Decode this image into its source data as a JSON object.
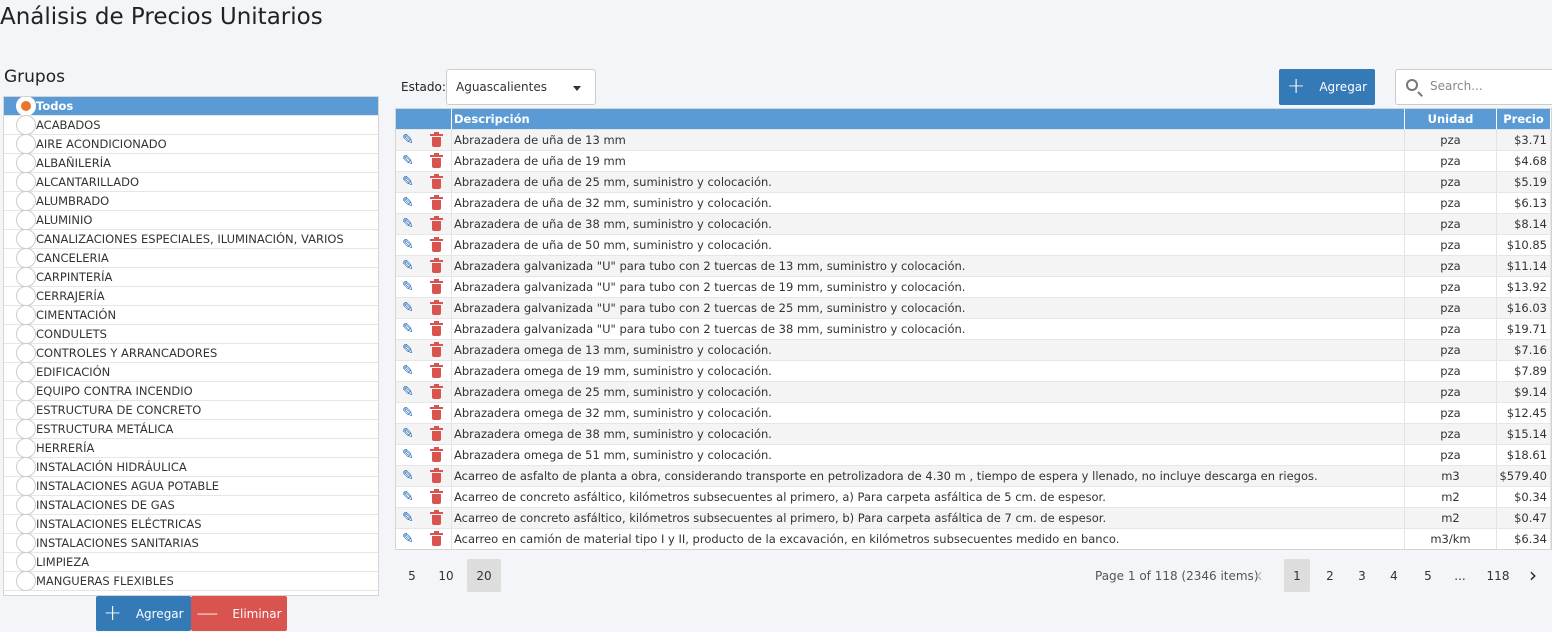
{
  "page_title": "Análisis de Precios Unitarios",
  "groups": {
    "title": "Grupos",
    "items": [
      {
        "label": "Todos",
        "selected": true
      },
      {
        "label": "ACABADOS"
      },
      {
        "label": "AIRE ACONDICIONADO"
      },
      {
        "label": "ALBAÑILERÍA"
      },
      {
        "label": "ALCANTARILLADO"
      },
      {
        "label": "ALUMBRADO"
      },
      {
        "label": "ALUMINIO"
      },
      {
        "label": "CANALIZACIONES ESPECIALES, ILUMINACIÓN, VARIOS"
      },
      {
        "label": "CANCELERIA"
      },
      {
        "label": "CARPINTERÍA"
      },
      {
        "label": "CERRAJERÍA"
      },
      {
        "label": "CIMENTACIÓN"
      },
      {
        "label": "CONDULETS"
      },
      {
        "label": "CONTROLES Y ARRANCADORES"
      },
      {
        "label": "EDIFICACIÓN"
      },
      {
        "label": "EQUIPO CONTRA INCENDIO"
      },
      {
        "label": "ESTRUCTURA DE CONCRETO"
      },
      {
        "label": "ESTRUCTURA METÁLICA"
      },
      {
        "label": "HERRERÍA"
      },
      {
        "label": "INSTALACIÓN HIDRÁULICA"
      },
      {
        "label": "INSTALACIONES AGUA POTABLE"
      },
      {
        "label": "INSTALACIONES DE GAS"
      },
      {
        "label": "INSTALACIONES ELÉCTRICAS"
      },
      {
        "label": "INSTALACIONES SANITARIAS"
      },
      {
        "label": "LIMPIEZA"
      },
      {
        "label": "MANGUERAS FLEXIBLES"
      }
    ],
    "add_label": "Agregar",
    "delete_label": "Eliminar"
  },
  "toolbar": {
    "estado_label": "Estado:",
    "estado_value": "Aguascalientes",
    "add_label": "Agregar",
    "search_placeholder": "Search..."
  },
  "table": {
    "columns": [
      "Descripción",
      "Unidad",
      "Precio"
    ],
    "rows": [
      [
        "Abrazadera de uña de 13 mm",
        "pza",
        "$3.71"
      ],
      [
        "Abrazadera de uña de 19 mm",
        "pza",
        "$4.68"
      ],
      [
        "Abrazadera de uña de 25 mm, suministro y colocación.",
        "pza",
        "$5.19"
      ],
      [
        "Abrazadera de uña de 32 mm, suministro y colocación.",
        "pza",
        "$6.13"
      ],
      [
        "Abrazadera de uña de 38 mm, suministro y colocación.",
        "pza",
        "$8.14"
      ],
      [
        "Abrazadera de uña de 50 mm, suministro y colocación.",
        "pza",
        "$10.85"
      ],
      [
        "Abrazadera galvanizada \"U\" para tubo con 2 tuercas de 13 mm, suministro y colocación.",
        "pza",
        "$11.14"
      ],
      [
        "Abrazadera galvanizada \"U\" para tubo con 2 tuercas de 19 mm, suministro y colocación.",
        "pza",
        "$13.92"
      ],
      [
        "Abrazadera galvanizada \"U\" para tubo con 2 tuercas de 25 mm, suministro y colocación.",
        "pza",
        "$16.03"
      ],
      [
        "Abrazadera galvanizada \"U\" para tubo con 2 tuercas de 38 mm, suministro y colocación.",
        "pza",
        "$19.71"
      ],
      [
        "Abrazadera omega de 13 mm, suministro y colocación.",
        "pza",
        "$7.16"
      ],
      [
        "Abrazadera omega de 19 mm, suministro y colocación.",
        "pza",
        "$7.89"
      ],
      [
        "Abrazadera omega de 25 mm, suministro y colocación.",
        "pza",
        "$9.14"
      ],
      [
        "Abrazadera omega de 32 mm, suministro y colocación.",
        "pza",
        "$12.45"
      ],
      [
        "Abrazadera omega de 38 mm, suministro y colocación.",
        "pza",
        "$15.14"
      ],
      [
        "Abrazadera omega de 51 mm, suministro y colocación.",
        "pza",
        "$18.61"
      ],
      [
        "Acarreo de asfalto de planta a obra, considerando transporte en petrolizadora de 4.30 m , tiempo de espera y llenado, no incluye descarga en riegos.",
        "m3",
        "$579.40"
      ],
      [
        "Acarreo de concreto asfáltico, kilómetros subsecuentes al primero, a) Para carpeta asfáltica de 5 cm. de espesor.",
        "m2",
        "$0.34"
      ],
      [
        "Acarreo de concreto asfáltico, kilómetros subsecuentes al primero, b) Para carpeta asfáltica de 7 cm. de espesor.",
        "m2",
        "$0.47"
      ],
      [
        "Acarreo en camión de material tipo I y II, producto de la excavación, en kilómetros subsecuentes medido en banco.",
        "m3/km",
        "$6.34"
      ]
    ]
  },
  "pager": {
    "page_sizes": [
      "5",
      "10",
      "20"
    ],
    "active_size": "20",
    "info": "Page 1 of 118 (2346 items)",
    "pages": [
      "1",
      "2",
      "3",
      "4",
      "5",
      "...",
      "118"
    ],
    "active_page": "1"
  },
  "colors": {
    "header": "#5b9bd5",
    "primary": "#337ab7",
    "danger": "#d9534f",
    "radio_dot": "#e8762c"
  }
}
